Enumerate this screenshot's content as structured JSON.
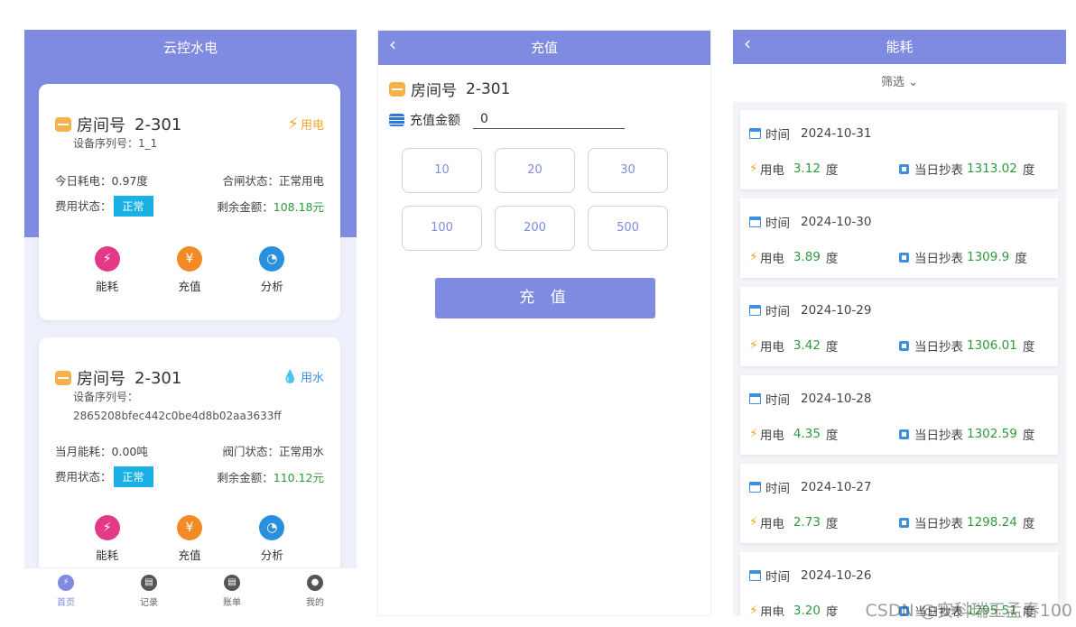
{
  "home": {
    "title": "云控水电",
    "cards": [
      {
        "room_label": "房间号",
        "room_no": "2-301",
        "type": "用电",
        "serial_label": "设备序列号：",
        "serial_value": "1_1",
        "usage_label": "今日耗电：",
        "usage_value": "0.97度",
        "switch_label": "合闸状态：",
        "switch_value": "正常用电",
        "fee_label": "费用状态：",
        "fee_value": "正常",
        "balance_label": "剩余金额：",
        "balance_value": "108.18元"
      },
      {
        "room_label": "房间号",
        "room_no": "2-301",
        "type": "用水",
        "serial_label": "设备序列号：",
        "serial_value": "2865208bfec442c0be4d8b02aa3633ff",
        "usage_label": "当月能耗：",
        "usage_value": "0.00吨",
        "switch_label": "阀门状态：",
        "switch_value": "正常用水",
        "fee_label": "费用状态：",
        "fee_value": "正常",
        "balance_label": "剩余金额：",
        "balance_value": "110.12元"
      }
    ],
    "actions": [
      "能耗",
      "充值",
      "分析"
    ],
    "tabs": [
      "首页",
      "记录",
      "账单",
      "我的"
    ]
  },
  "recharge": {
    "title": "充值",
    "room_label": "房间号",
    "room_no": "2-301",
    "amount_label": "充值金额",
    "amount_value": "0",
    "options": [
      "10",
      "20",
      "30",
      "100",
      "200",
      "500"
    ],
    "submit": "充 值"
  },
  "energy": {
    "title": "能耗",
    "filter": "筛选",
    "time_label": "时间",
    "elec_label": "用电",
    "unit": "度",
    "meter_label": "当日抄表",
    "records": [
      {
        "date": "2024-10-31",
        "usage": "3.12",
        "meter": "1313.02"
      },
      {
        "date": "2024-10-30",
        "usage": "3.89",
        "meter": "1309.9"
      },
      {
        "date": "2024-10-29",
        "usage": "3.42",
        "meter": "1306.01"
      },
      {
        "date": "2024-10-28",
        "usage": "4.35",
        "meter": "1302.59"
      },
      {
        "date": "2024-10-27",
        "usage": "2.73",
        "meter": "1298.24"
      },
      {
        "date": "2024-10-26",
        "usage": "3.20",
        "meter": "1295.51"
      }
    ]
  },
  "watermark": "CSDN @安科瑞王孟春100",
  "colors": {
    "accent": "#7f8be0",
    "badge": "#1ab0e6",
    "value_green": "#2e9a3c",
    "elec_orange": "#f3a62f",
    "water_blue": "#3d8fe0"
  }
}
